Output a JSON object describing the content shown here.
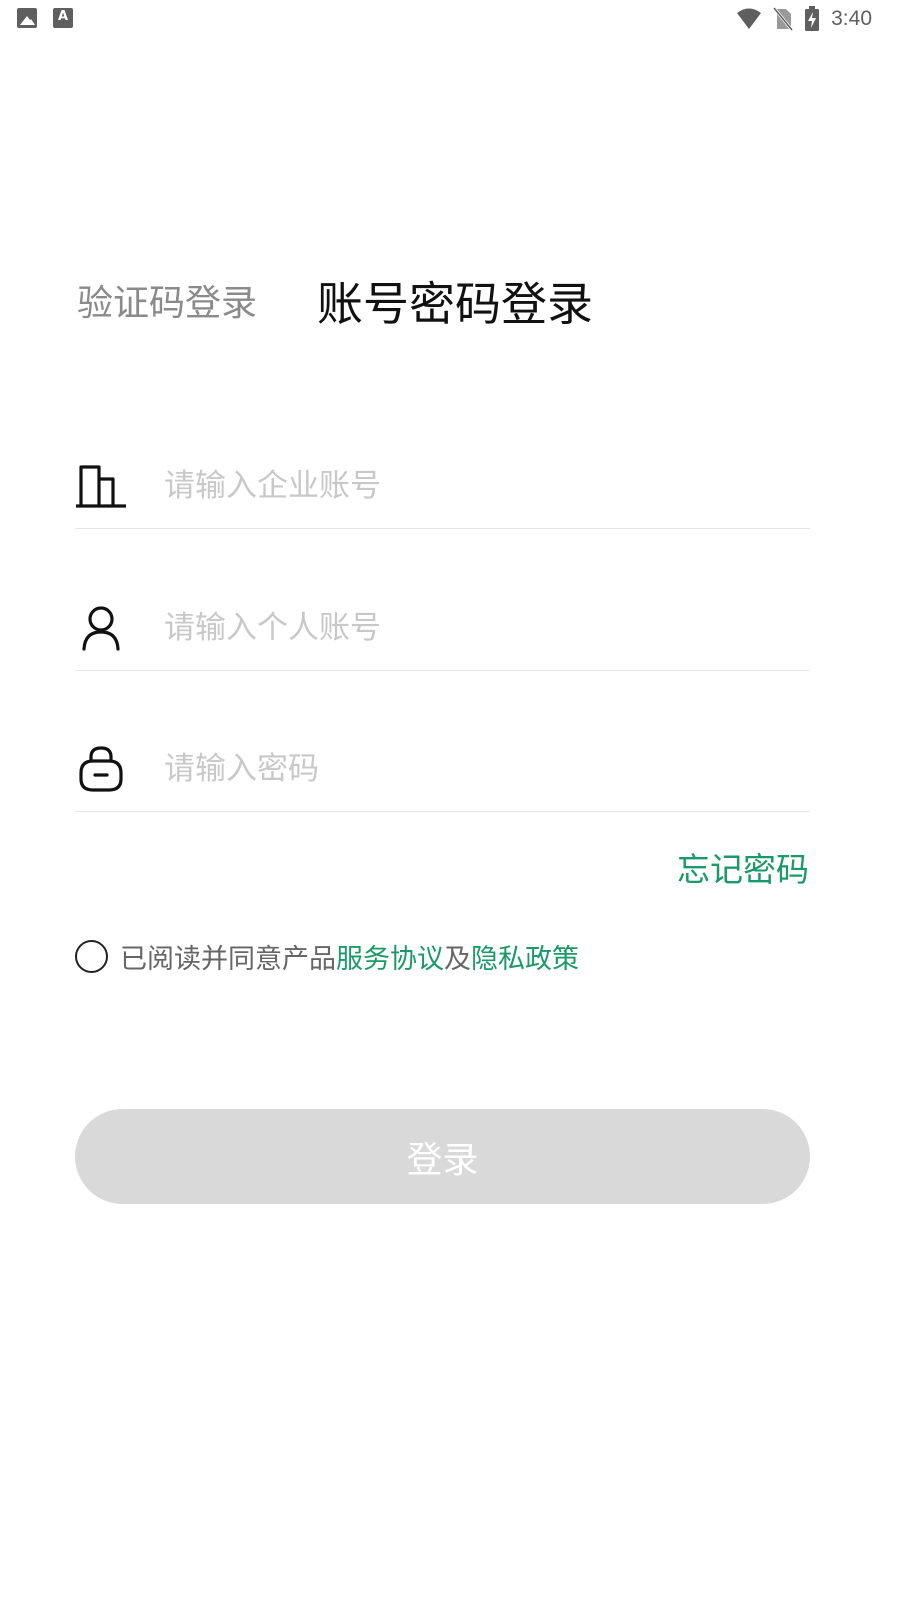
{
  "status_bar": {
    "time": "3:40",
    "left_icons": [
      "gallery-icon",
      "font-a-icon"
    ],
    "right_icons": [
      "wifi-icon",
      "no-sim-icon",
      "battery-charging-icon"
    ]
  },
  "tabs": {
    "sms_login": "验证码登录",
    "password_login": "账号密码登录",
    "active": "password_login"
  },
  "form": {
    "company_account": {
      "placeholder": "请输入企业账号",
      "value": "",
      "icon": "building-icon"
    },
    "personal_account": {
      "placeholder": "请输入个人账号",
      "value": "",
      "icon": "user-icon"
    },
    "password": {
      "placeholder": "请输入密码",
      "value": "",
      "icon": "lock-icon"
    }
  },
  "forgot_password": "忘记密码",
  "agreement": {
    "checked": false,
    "prefix": "已阅读并同意产品",
    "service_link": "服务协议",
    "and": "及",
    "privacy_link": "隐私政策"
  },
  "login_button": {
    "label": "登录",
    "enabled": false
  },
  "colors": {
    "accent": "#1a9a6a",
    "button_disabled": "#d9d9d9",
    "placeholder": "#c8c8c8",
    "inactive_tab": "#8a8a8a"
  }
}
